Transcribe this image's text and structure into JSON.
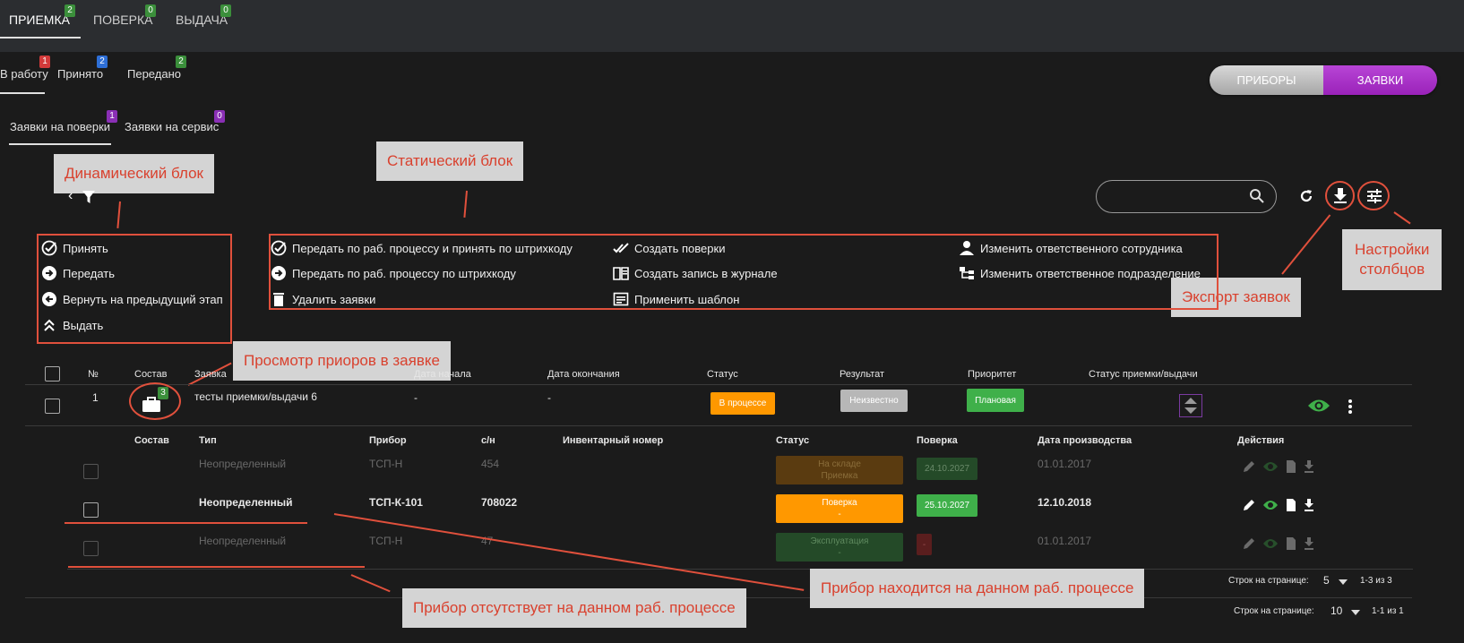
{
  "top_tabs": [
    {
      "label": "ПРИЕМКА",
      "badge": "2"
    },
    {
      "label": "ПОВЕРКА",
      "badge": "0"
    },
    {
      "label": "ВЫДАЧА",
      "badge": "0"
    }
  ],
  "sub_tabs": [
    {
      "label": "В работу",
      "badge": "1"
    },
    {
      "label": "Принято",
      "badge": "2"
    },
    {
      "label": "Передано",
      "badge": "2"
    }
  ],
  "req_tabs": [
    {
      "label": "Заявки на поверки",
      "badge": "1"
    },
    {
      "label": "Заявки на сервис",
      "badge": "0"
    }
  ],
  "toggle": {
    "devices": "ПРИБОРЫ",
    "requests": "ЗАЯВКИ"
  },
  "callouts": {
    "dynamic": "Динамический блок",
    "static": "Статический блок",
    "columns_settings_line1": "Настройки",
    "columns_settings_line2": "столбцов",
    "export": "Экспорт заявок",
    "view_devices": "Просмотр приоров в заявке",
    "device_here": "Прибор находится на данном раб. процессе",
    "device_absent": "Прибор  отсутствует на данном раб. процессе"
  },
  "dynamic_actions": [
    "Принять",
    "Передать",
    "Вернуть на предыдущий этап",
    "Выдать"
  ],
  "static_actions": [
    "Передать по раб. процессу и принять по штрихкоду",
    "Передать по раб. процессу по штрихкоду",
    "Удалить заявки",
    "Создать поверки",
    "Создать запись в журнале",
    "Применить шаблон",
    "Изменить ответственного сотрудника",
    "Изменить ответственное подразделение"
  ],
  "main_table": {
    "headers": [
      "№",
      "Состав",
      "Заявка",
      "Дата начала",
      "Дата окончания",
      "Статус",
      "Результат",
      "Приоритет",
      "Статус приемки/выдачи"
    ],
    "row": {
      "num": "1",
      "count": "3",
      "name": "тесты приемки/выдачи 6",
      "start": "-",
      "end": "-",
      "status": "В процессе",
      "result": "Неизвестно",
      "priority": "Плановая"
    }
  },
  "sub_table": {
    "headers": [
      "Состав",
      "Тип",
      "Прибор",
      "с/н",
      "Инвентарный номер",
      "Статус",
      "Поверка",
      "Дата производства",
      "Действия"
    ],
    "rows": [
      {
        "type": "Неопределенный",
        "device": "ТСП-Н",
        "sn": "454",
        "status1": "На складе",
        "status2": "Приемка",
        "verify": "24.10.2027",
        "date": "01.01.2017"
      },
      {
        "type": "Неопределенный",
        "device": "ТСП-К-101",
        "sn": "708022",
        "status1": "Поверка",
        "status2": "-",
        "verify": "25.10.2027",
        "date": "12.10.2018"
      },
      {
        "type": "Неопределенный",
        "device": "ТСП-Н",
        "sn": "47",
        "status1": "Эксплуатация",
        "status2": "-",
        "verify": "-",
        "date": "01.01.2017"
      }
    ]
  },
  "pagination": [
    {
      "label": "Строк на странице:",
      "value": "5",
      "range": "1-3 из 3"
    },
    {
      "label": "Строк на странице:",
      "value": "10",
      "range": "1-1 из 1"
    }
  ],
  "colors": {
    "accent_purple": "#9a22b9",
    "callout_red": "#e0503c",
    "orange": "#ff9800",
    "green": "#3fb04a"
  }
}
